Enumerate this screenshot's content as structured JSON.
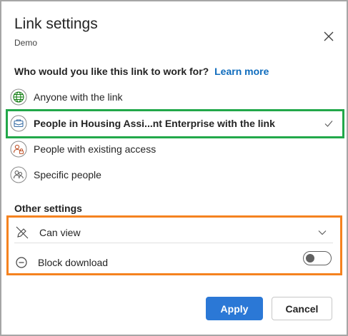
{
  "dialog": {
    "title": "Link settings",
    "subtitle": "Demo",
    "close_icon": "close-icon"
  },
  "audience": {
    "question": "Who would you like this link to work for?",
    "learn_more": "Learn more",
    "options": [
      {
        "label": "Anyone with the link",
        "icon": "globe-icon",
        "selected": false
      },
      {
        "label": "People in Housing Assi...nt Enterprise with the link",
        "icon": "organization-icon",
        "selected": true
      },
      {
        "label": "People with existing access",
        "icon": "existing-access-icon",
        "selected": false
      },
      {
        "label": "Specific people",
        "icon": "people-icon",
        "selected": false
      }
    ]
  },
  "other_settings": {
    "heading": "Other settings",
    "permission": {
      "label": "Can view",
      "icon": "pencil-off-icon"
    },
    "block_download": {
      "label": "Block download",
      "icon": "block-icon",
      "enabled": false
    }
  },
  "footer": {
    "apply_label": "Apply",
    "cancel_label": "Cancel"
  },
  "colors": {
    "accent": "#2b78d6",
    "link": "#0f6cbd",
    "highlight_green": "#22a84a",
    "highlight_orange": "#f5821f"
  }
}
